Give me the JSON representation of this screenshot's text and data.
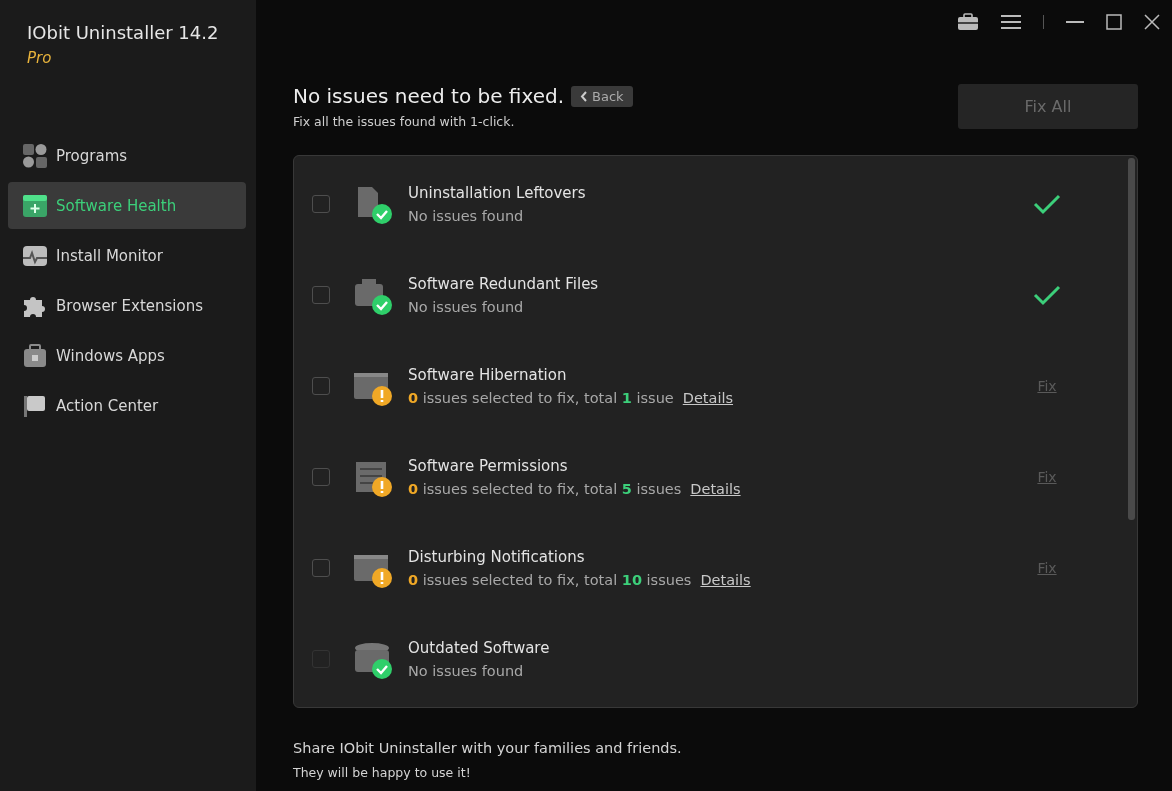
{
  "app": {
    "title": "IObit Uninstaller 14.2",
    "edition": "Pro"
  },
  "sidebar": {
    "items": [
      {
        "label": "Programs",
        "selected": false
      },
      {
        "label": "Software Health",
        "selected": true
      },
      {
        "label": "Install Monitor",
        "selected": false
      },
      {
        "label": "Browser Extensions",
        "selected": false
      },
      {
        "label": "Windows Apps",
        "selected": false
      },
      {
        "label": "Action Center",
        "selected": false
      }
    ]
  },
  "header": {
    "title": "No issues need to be fixed.",
    "back": "Back",
    "subtitle": "Fix all the issues found with 1-click.",
    "fix_all": {
      "label": "Fix All",
      "disabled": true
    }
  },
  "rows": [
    {
      "kind": "ok",
      "title": "Uninstallation Leftovers",
      "status": "No issues found",
      "checked": false,
      "disabled": false
    },
    {
      "kind": "ok",
      "title": "Software Redundant Files",
      "status": "No issues found",
      "checked": false,
      "disabled": false
    },
    {
      "kind": "issues",
      "title": "Software Hibernation",
      "selected_count": "0",
      "text_1": "issues selected to fix, total",
      "total": "1",
      "text_2": "issue",
      "details": "Details",
      "fix": "Fix",
      "checked": false,
      "disabled": false
    },
    {
      "kind": "issues",
      "title": "Software Permissions",
      "selected_count": "0",
      "text_1": "issues selected to fix, total",
      "total": "5",
      "text_2": "issues",
      "details": "Details",
      "fix": "Fix",
      "checked": false,
      "disabled": false
    },
    {
      "kind": "issues",
      "title": "Disturbing Notifications",
      "selected_count": "0",
      "text_1": "issues selected to fix, total",
      "total": "10",
      "text_2": "issues",
      "details": "Details",
      "fix": "Fix",
      "checked": false,
      "disabled": false
    },
    {
      "kind": "skipped",
      "title": "Outdated Software",
      "status": "No issues found",
      "checked": false,
      "disabled": true
    }
  ],
  "footer": {
    "line_1": "Share IObit Uninstaller with your families and friends.",
    "line_2": "They will be happy to use it!"
  }
}
